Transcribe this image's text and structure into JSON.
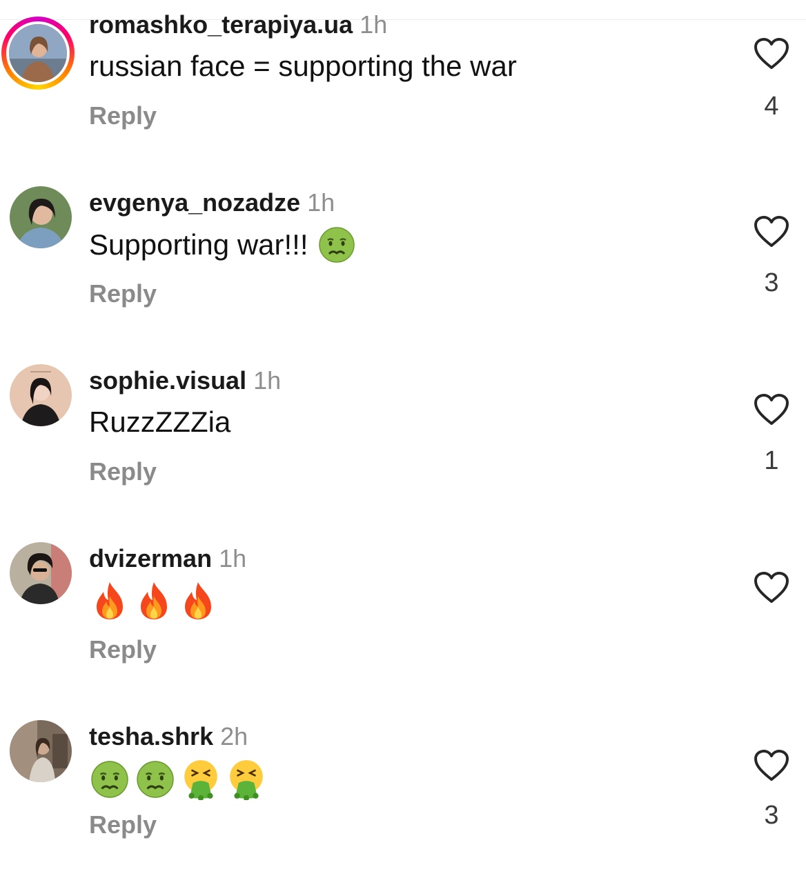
{
  "comments": [
    {
      "username": "romashko_terapiya.ua",
      "time": "1h",
      "text": "russian face = supporting the war",
      "emojis": [],
      "reply_label": "Reply",
      "likes": "4",
      "has_story": true
    },
    {
      "username": "evgenya_nozadze",
      "time": "1h",
      "text": "Supporting war!!!",
      "emojis": [
        "nauseated-face"
      ],
      "reply_label": "Reply",
      "likes": "3",
      "has_story": false
    },
    {
      "username": "sophie.visual",
      "time": "1h",
      "text": "RuzzZZZia",
      "emojis": [],
      "reply_label": "Reply",
      "likes": "1",
      "has_story": false
    },
    {
      "username": "dvizerman",
      "time": "1h",
      "text": "",
      "emojis": [
        "fire",
        "fire",
        "fire"
      ],
      "reply_label": "Reply",
      "likes": "",
      "has_story": false
    },
    {
      "username": "tesha.shrk",
      "time": "2h",
      "text": "",
      "emojis": [
        "nauseated-face",
        "nauseated-face",
        "vomiting-face",
        "vomiting-face"
      ],
      "reply_label": "Reply",
      "likes": "3",
      "has_story": false
    }
  ],
  "icons": {
    "like": "heart-outline-icon"
  },
  "colors": {
    "username": "#1a1a1a",
    "timestamp": "#8e8e8e",
    "reply": "#8a8a8a",
    "story_ring_start": "#d300c5",
    "story_ring_end": "#ffd600"
  }
}
